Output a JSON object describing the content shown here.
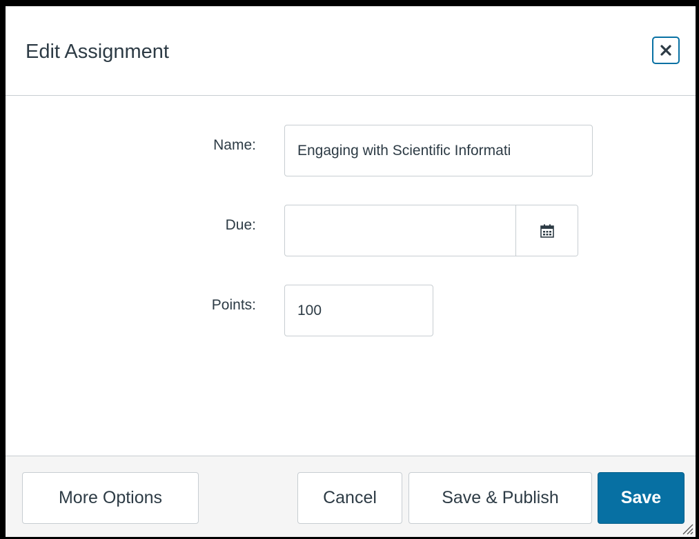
{
  "dialog": {
    "title": "Edit Assignment",
    "close_icon": "close-x-icon"
  },
  "form": {
    "name": {
      "label": "Name:",
      "value": "Engaging with Scientific Informati"
    },
    "due": {
      "label": "Due:",
      "value": "",
      "calendar_icon": "calendar-icon"
    },
    "points": {
      "label": "Points:",
      "value": "100"
    }
  },
  "footer": {
    "more_options_label": "More Options",
    "cancel_label": "Cancel",
    "save_publish_label": "Save & Publish",
    "save_label": "Save"
  },
  "colors": {
    "primary": "#0770a3",
    "text": "#2d3b45",
    "border": "#c7cdd1",
    "footer_bg": "#f5f5f5"
  }
}
